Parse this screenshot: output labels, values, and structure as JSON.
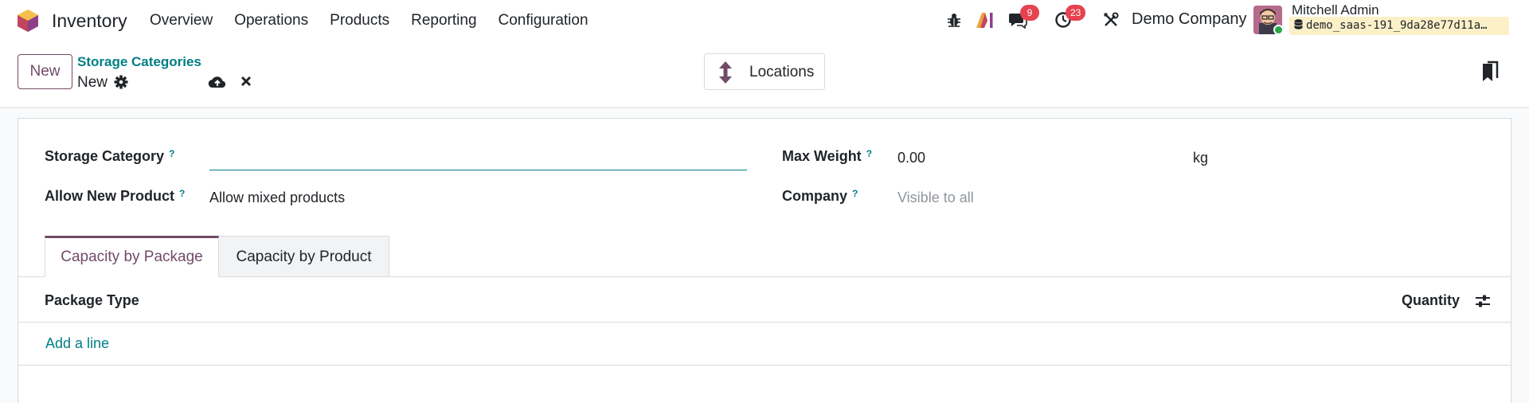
{
  "navbar": {
    "app_name": "Inventory",
    "menu": [
      "Overview",
      "Operations",
      "Products",
      "Reporting",
      "Configuration"
    ],
    "messages_badge": "9",
    "activities_badge": "23",
    "company": "Demo Company",
    "user_name": "Mitchell Admin",
    "database": "demo_saas-191_9da28e77d11a…",
    "icons": [
      "app-logo-icon",
      "debug-bug-icon",
      "ai-icon",
      "chat-icon",
      "clock-icon",
      "tools-icon",
      "database-icon"
    ]
  },
  "control_panel": {
    "new_button": "New",
    "breadcrumb_parent": "Storage Categories",
    "record_name": "New",
    "smart_button_label": "Locations"
  },
  "form": {
    "storage_category_label": "Storage Category",
    "storage_category_value": "",
    "allow_new_product_label": "Allow New Product",
    "allow_new_product_value": "Allow mixed products",
    "max_weight_label": "Max Weight",
    "max_weight_value": "0.00",
    "max_weight_unit": "kg",
    "company_label": "Company",
    "company_placeholder": "Visible to all",
    "help_marker": "?"
  },
  "tabs": [
    {
      "label": "Capacity by Package",
      "active": true
    },
    {
      "label": "Capacity by Product",
      "active": false
    }
  ],
  "lines_table": {
    "columns": [
      "Package Type",
      "Quantity"
    ],
    "add_line": "Add a line"
  },
  "colors": {
    "brand": "#714b67",
    "link": "#017e84",
    "badge": "#e6424f"
  }
}
